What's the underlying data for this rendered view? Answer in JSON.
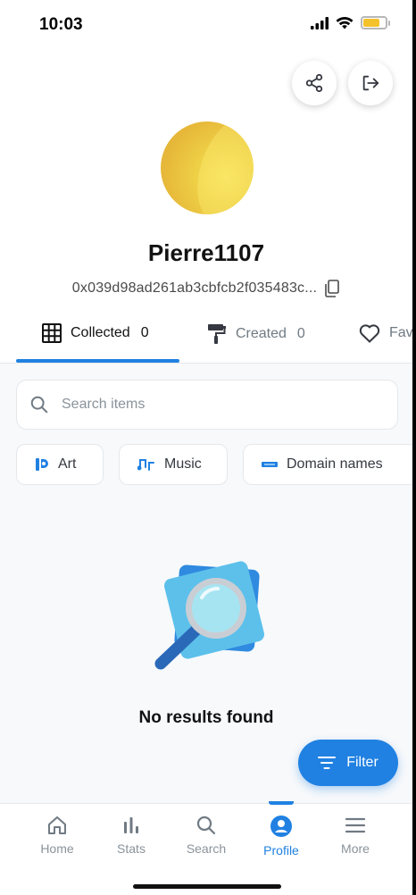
{
  "status_bar": {
    "time": "10:03"
  },
  "profile": {
    "username": "Pierre1107",
    "address": "0x039d98ad261ab3cbfcb2f035483c..."
  },
  "tabs": [
    {
      "label": "Collected",
      "count": "0",
      "icon": "grid-icon",
      "active": true
    },
    {
      "label": "Created",
      "count": "0",
      "icon": "paint-roller-icon"
    },
    {
      "label": "Fav",
      "icon": "heart-icon"
    }
  ],
  "search": {
    "placeholder": "Search items"
  },
  "chips": [
    {
      "label": "Art",
      "icon": "art-icon"
    },
    {
      "label": "Music",
      "icon": "music-icon"
    },
    {
      "label": "Domain names",
      "icon": "domain-icon"
    }
  ],
  "empty_state": {
    "message": "No results found"
  },
  "filter_button": {
    "label": "Filter"
  },
  "bottom_nav": [
    {
      "label": "Home",
      "icon": "home-icon"
    },
    {
      "label": "Stats",
      "icon": "stats-icon"
    },
    {
      "label": "Search",
      "icon": "search-icon"
    },
    {
      "label": "Profile",
      "icon": "profile-icon",
      "active": true
    },
    {
      "label": "More",
      "icon": "menu-icon"
    }
  ],
  "colors": {
    "accent": "#2081e2",
    "text": "#121212",
    "muted": "#8a939b",
    "avatar": "#e9c441"
  }
}
